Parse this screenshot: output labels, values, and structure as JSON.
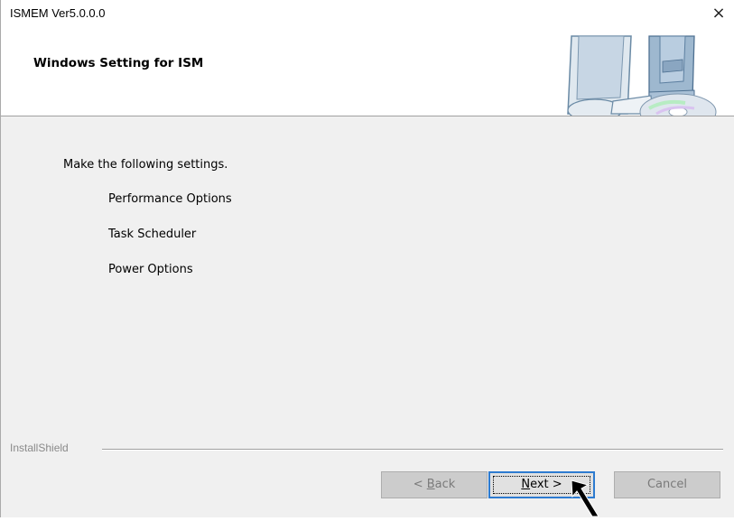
{
  "window": {
    "title": "ISMEM Ver5.0.0.0",
    "close_label": "×"
  },
  "header": {
    "title": "Windows Setting for ISM",
    "graphic_icon": "computer-setup-icon"
  },
  "content": {
    "intro": "Make the following settings.",
    "options": [
      "Performance Options",
      "Task Scheduler",
      "Power Options"
    ]
  },
  "footer": {
    "brand": "InstallShield",
    "back_prefix": "< ",
    "back_mnemonic": "B",
    "back_rest": "ack",
    "next_mnemonic": "N",
    "next_rest": "ext >",
    "cancel_label": "Cancel"
  },
  "colors": {
    "dialog_bg": "#f0f0f0",
    "header_bg": "#ffffff",
    "focus_border": "#2d7bd0"
  }
}
